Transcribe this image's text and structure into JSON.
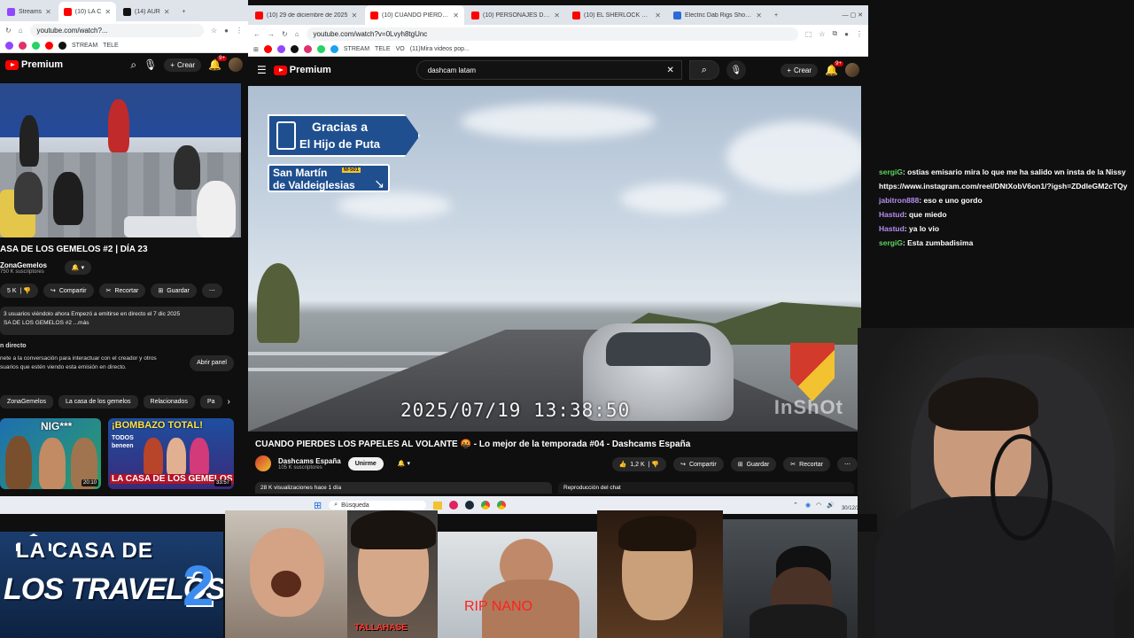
{
  "left_browser": {
    "tabs": [
      {
        "label": "Streams",
        "favicon_color": "#9146ff",
        "active": false
      },
      {
        "label": "(10) LA C",
        "favicon_color": "#ff0000",
        "active": true
      },
      {
        "label": "(14) AUR",
        "favicon_color": "#111111",
        "active": false
      }
    ],
    "url": "youtube.com/watch?...",
    "bookmark": "STREAM",
    "bookmark2": "TELE",
    "yt_brand": "Premium",
    "crear_label": "Crear",
    "notif_badge": "9+",
    "video_title": "ASA DE LOS GEMELOS #2 | DÍA 23",
    "channel_name": "ZonaGemelos",
    "channel_subs": "750 K suscriptores",
    "likes": "5 K",
    "share_label": "Compartir",
    "clip_label": "Recortar",
    "save_label": "Guardar",
    "desc_line1": "3 usuarios viéndolo ahora  Empezó a emitirse en directo el 7 dic 2025",
    "desc_line2": "SA DE LOS GEMELOS #2 ...más",
    "chat_header": "n directo",
    "chat_line1": "nete a la conversación para interactuar con el creador y otros",
    "chat_line2": "suarios que estén viendo esta emisión en directo.",
    "open_panel": "Abrir panel",
    "chips": [
      "ZonaGemelos",
      "La casa de los gemelos",
      "Relacionados",
      "Pa"
    ],
    "thumb1_text": "NIG***",
    "thumb1_duration": "20:10",
    "thumb2_top": "¡BOMBAZO TOTAL!",
    "thumb2_mid": "TODOS beneen",
    "thumb2_bottom": "LA CASA DE LOS GEMELOS",
    "thumb2_duration": "33:57"
  },
  "main_browser": {
    "tabs": [
      {
        "label": "(10) 29 de diciembre de 2025",
        "favicon_color": "#ff0000",
        "active": false
      },
      {
        "label": "(10) CUANDO PIERDES L",
        "favicon_color": "#ff0000",
        "active": true
      },
      {
        "label": "(10) PERSONAJES DE LA ISR",
        "favicon_color": "#ff0000",
        "active": false
      },
      {
        "label": "(10) EL SHERLOCK HOLMES",
        "favicon_color": "#ff0000",
        "active": false
      },
      {
        "label": "Electric Dab Rigs Shop | Puff",
        "favicon_color": "#2a6ad8",
        "active": false
      }
    ],
    "url": "youtube.com/watch?v=0Lvyh8tgUnc",
    "bookmarks": [
      "STREAM",
      "TELE",
      "VO",
      "(11)Mira videos pop..."
    ],
    "yt_brand": "Premium",
    "search_query": "dashcam latam",
    "crear_label": "Crear",
    "notif_badge": "9+",
    "sign_line1": "Gracias a",
    "sign_line2": "El Hijo de Puta",
    "sub_sign_line1": "San Martín",
    "sub_sign_badge": "M-501",
    "sub_sign_line2": "de Valdeiglesias",
    "timestamp": "2025/07/19  13:38:50",
    "watermark": "InShOt",
    "video_title": "CUANDO PIERDES LOS PAPELES AL VOLANTE 🤬 - Lo mejor de la temporada #04 - Dashcams España",
    "channel_name": "Dashcams España",
    "channel_subs": "105 K suscriptores",
    "join_label": "Unirme",
    "likes": "1,2 K",
    "share_label": "Compartir",
    "save_label": "Guardar",
    "clip_label": "Recortar",
    "views": "28 K visualizaciones  hace 1 día",
    "chat_replay": "Reproducción del chat"
  },
  "taskbar": {
    "search_placeholder": "Búsqueda",
    "time": "1:44",
    "date": "30/12/2025"
  },
  "chat": [
    {
      "user": "sergiG",
      "color": "#5fd35f",
      "text": ": ostias emisario mira lo que me ha salido wn insta de la Nissy"
    },
    {
      "user": "",
      "color": "#ffffff",
      "text": "https://www.instagram.com/reel/DNtXobV6on1/?igsh=ZDdleGM2cTQy"
    },
    {
      "user": "jabitron888",
      "color": "#b58ef0",
      "text": ": eso e uno gordo"
    },
    {
      "user": "Hastud",
      "color": "#b58ef0",
      "text": ": que miedo"
    },
    {
      "user": "Hastud",
      "color": "#b58ef0",
      "text": ": ya lo vio"
    },
    {
      "user": "sergiG",
      "color": "#5fd35f",
      "text": ": Esta zumbadisima"
    }
  ],
  "bottom": {
    "banner_line1": "LA CASA DE",
    "banner_line2": "LOS TRAVELOS",
    "banner_number": "2",
    "cam2_caption": "TALLAHASE",
    "cam3_caption": "RIP NANO"
  }
}
